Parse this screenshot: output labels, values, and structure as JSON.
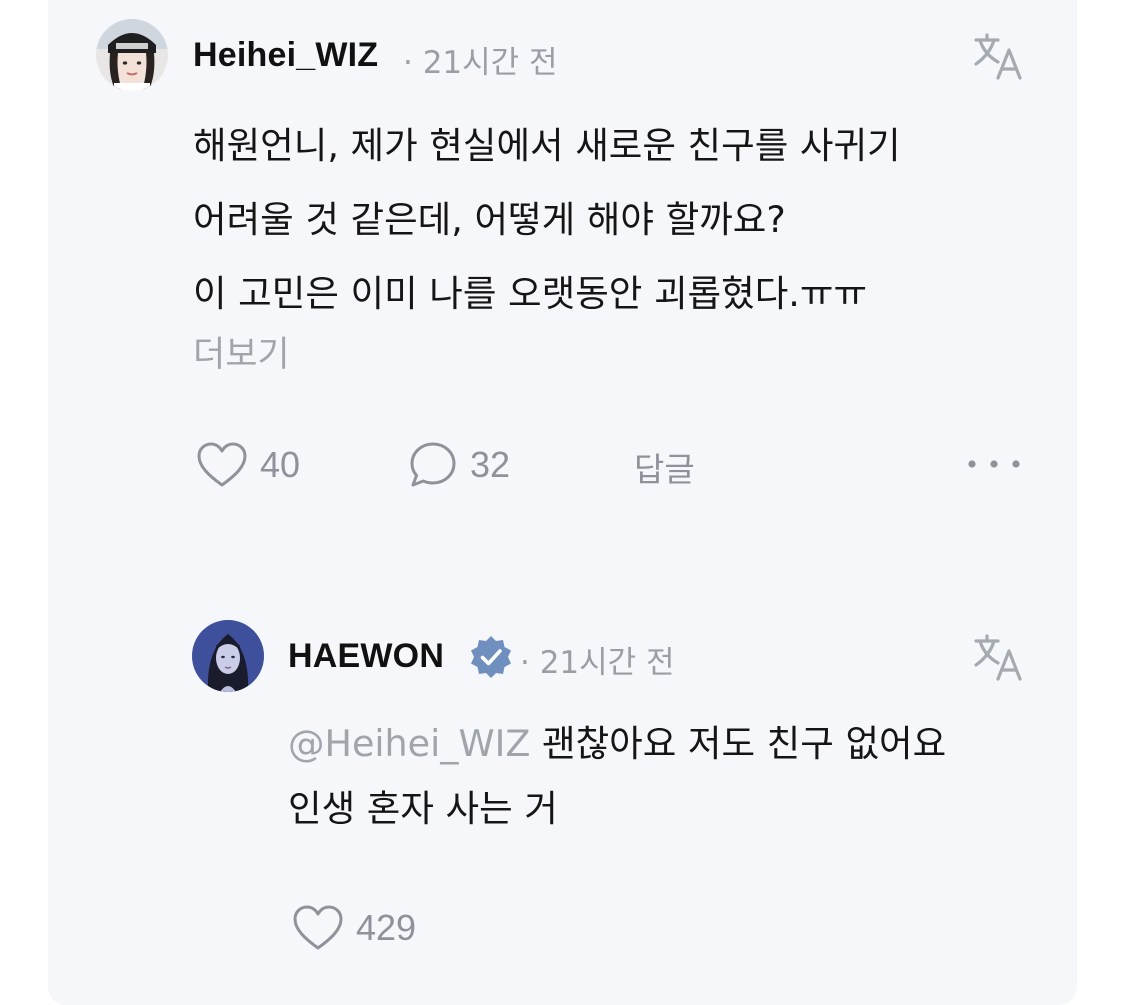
{
  "comment": {
    "username": "Heihei_WIZ",
    "time": "· 21시간 전",
    "avatar_icon": "user-avatar",
    "body_lines": [
      "해원언니, 제가 현실에서 새로운 친구를 사귀기",
      "어려울 것 같은데, 어떻게 해야 할까요?",
      "이 고민은 이미 나를 오랫동안 괴롭혔다.ㅠㅠ"
    ],
    "more_label": "더보기",
    "likes": "40",
    "comments": "32",
    "reply_label": "답글",
    "icons": [
      "translate-icon",
      "heart-icon",
      "comment-icon",
      "more-icon"
    ]
  },
  "reply": {
    "username": "HAEWON",
    "verified": true,
    "time": "· 21시간 전",
    "mention": "@Heihei_WIZ",
    "body_line1_rest": " 괜찮아요 저도 친구 없어요",
    "body_line2": "인생 혼자 사는 거",
    "likes": "429",
    "accent_color": "#6f8fbe"
  }
}
